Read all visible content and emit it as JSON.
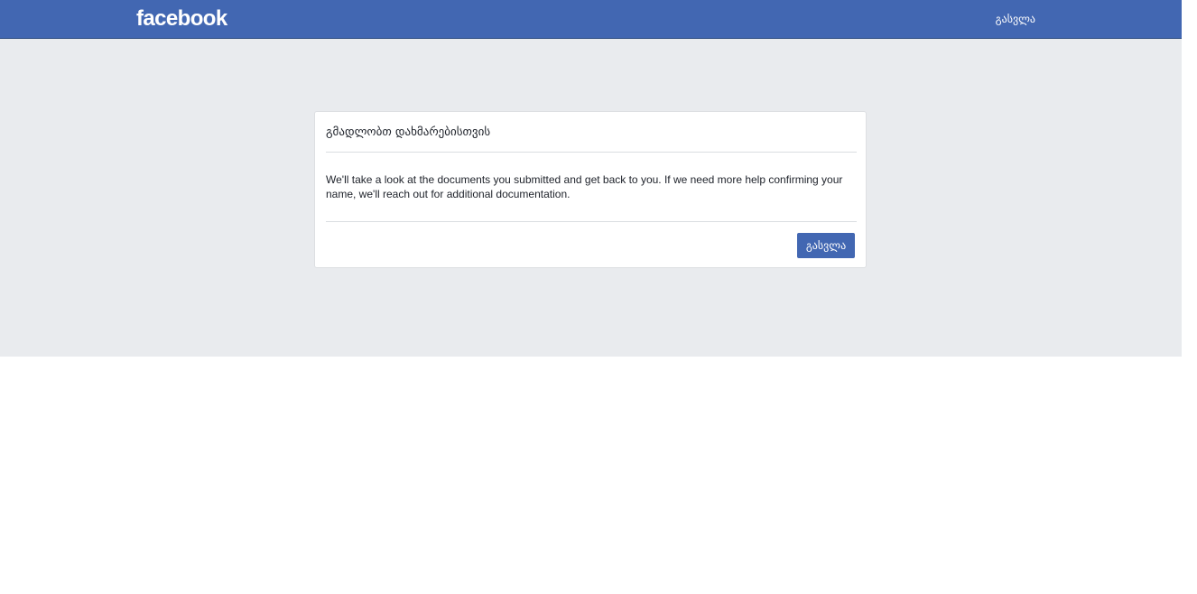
{
  "header": {
    "logo_text": "facebook",
    "logout_label": "გასვლა",
    "background_color": "#4267b2"
  },
  "card": {
    "title": "გმადლობთ დახმარებისთვის",
    "message": "We'll take a look at the documents you submitted and get back to you. If we need more help confirming your name, we'll reach out for additional documentation.",
    "logout_button_label": "გასვლა",
    "button_color": "#4267b2"
  },
  "page": {
    "background_color": "#e9ebee"
  }
}
